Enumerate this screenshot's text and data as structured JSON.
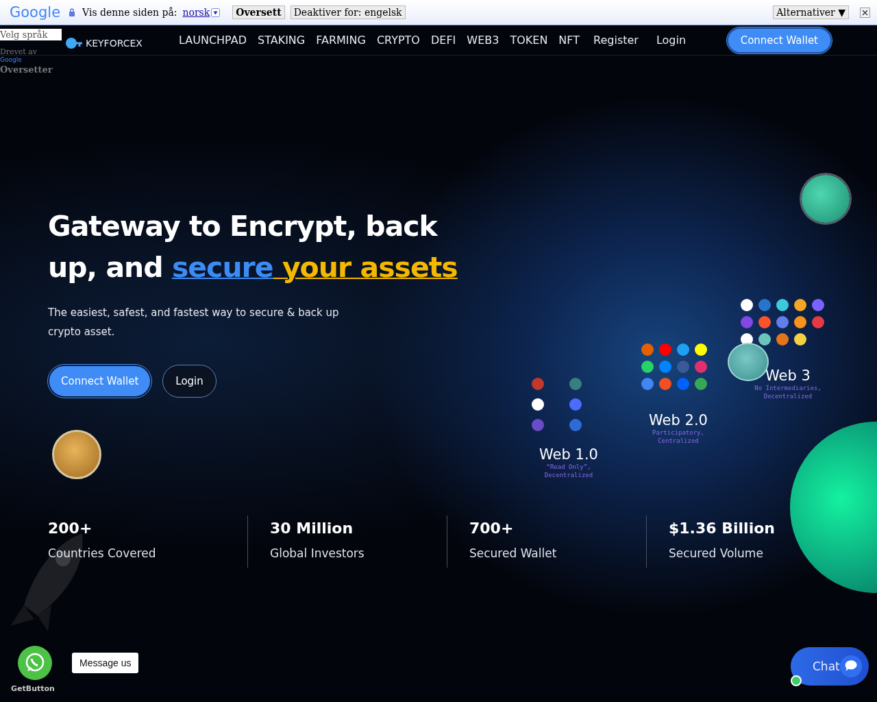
{
  "translate_bar": {
    "logo": "Google",
    "prompt": "Vis denne siden på:",
    "language": "norsk",
    "translate_button": "Oversett",
    "disable_button": "Deaktiver for: engelsk",
    "options_button": "Alternativer ▼"
  },
  "language_widget": {
    "select": "Velg språk",
    "powered_by": "Drevet av",
    "brand": "Google",
    "product": "Oversetter"
  },
  "nav": {
    "logo": "KEYFORCEX",
    "items": [
      "LAUNCHPAD",
      "STAKING",
      "FARMING",
      "CRYPTO",
      "DEFI",
      "WEB3",
      "TOKEN",
      "NFT"
    ],
    "links": [
      "Register",
      "Login"
    ],
    "cta": "Connect Wallet"
  },
  "hero": {
    "heading": [
      {
        "text": "Gateway to Encrypt, back up, and ",
        "kind": "plain"
      },
      {
        "text": "secure",
        "kind": "blue"
      },
      {
        "text": " your assets",
        "kind": "gold"
      }
    ],
    "subtitle": "The easiest, safest, and fastest way to secure & back up crypto asset.",
    "buttons": [
      {
        "label": "Connect Wallet",
        "kind": "primary"
      },
      {
        "label": "Login",
        "kind": "outline"
      }
    ]
  },
  "illustration": {
    "eras": [
      {
        "title": "Web 1.0",
        "caption": "“Read Only”, Decentralized"
      },
      {
        "title": "Web 2.0",
        "caption": "Participatory, Centralized"
      },
      {
        "title": "Web 3",
        "caption": "No Intermediaries, Decentralized"
      }
    ]
  },
  "stats": [
    {
      "value": "200+",
      "label": "Countries Covered"
    },
    {
      "value": "30 Million",
      "label": "Global Investors"
    },
    {
      "value": "700+",
      "label": "Secured Wallet"
    },
    {
      "value": "$1.36 Billion",
      "label": "Secured Volume"
    }
  ],
  "widgets": {
    "tooltip": "Message us",
    "brand": "GetButton",
    "chat": "Chat"
  }
}
